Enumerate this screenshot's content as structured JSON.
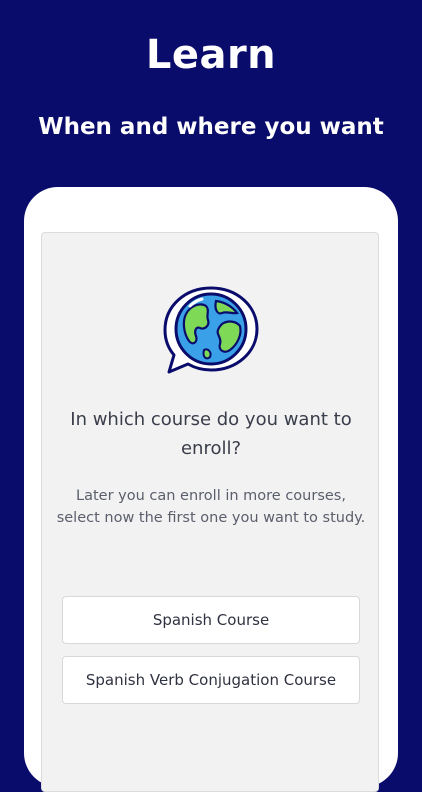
{
  "header": {
    "title": "Learn",
    "subtitle": "When and where you want"
  },
  "onboarding": {
    "icon": "globe-chat-bubble-icon",
    "question": "In which course do you want to enroll?",
    "hint": "Later you can enroll in more courses, select now the first one you want to study.",
    "courses": [
      {
        "label": "Spanish Course"
      },
      {
        "label": "Spanish Verb Conjugation Course"
      }
    ]
  },
  "colors": {
    "background": "#0a0c6b",
    "panel": "#f2f2f3",
    "globe_ocean": "#3aa0e8",
    "globe_land": "#7ed957"
  }
}
